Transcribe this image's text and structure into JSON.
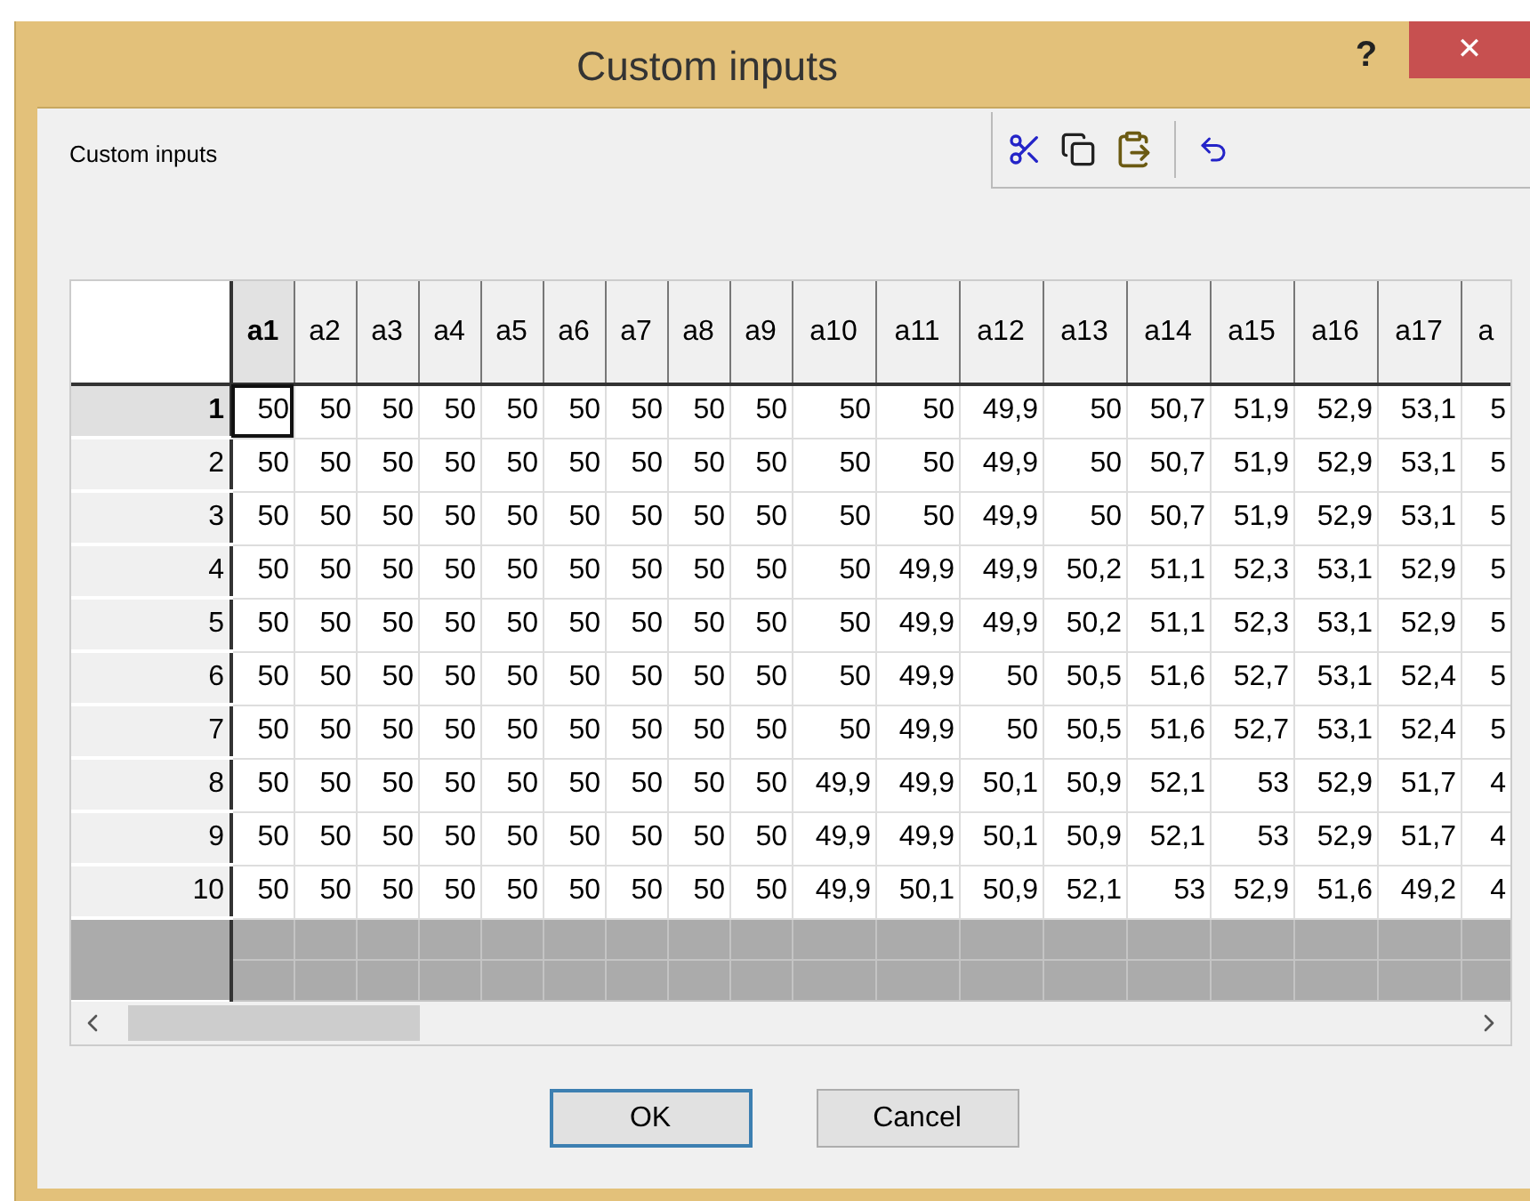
{
  "window": {
    "title": "Custom inputs",
    "help": "?",
    "close": "✕"
  },
  "panel_label": "Custom inputs",
  "toolbar": [
    {
      "kind": "cut"
    },
    {
      "kind": "copy"
    },
    {
      "kind": "paste"
    },
    {
      "kind": "separator"
    },
    {
      "kind": "undo"
    }
  ],
  "table": {
    "columns": [
      {
        "label": "a1",
        "selected": true
      },
      {
        "label": "a2",
        "selected": false
      },
      {
        "label": "a3",
        "selected": false
      },
      {
        "label": "a4",
        "selected": false
      },
      {
        "label": "a5",
        "selected": false
      },
      {
        "label": "a6",
        "selected": false
      },
      {
        "label": "a7",
        "selected": false
      },
      {
        "label": "a8",
        "selected": false
      },
      {
        "label": "a9",
        "selected": false
      },
      {
        "label": "a10",
        "selected": false
      },
      {
        "label": "a11",
        "selected": false
      },
      {
        "label": "a12",
        "selected": false
      },
      {
        "label": "a13",
        "selected": false
      },
      {
        "label": "a14",
        "selected": false
      },
      {
        "label": "a15",
        "selected": false
      },
      {
        "label": "a16",
        "selected": false
      },
      {
        "label": "a17",
        "selected": false
      },
      {
        "label": "a",
        "selected": false
      }
    ],
    "rows": [
      {
        "label": "1",
        "selected": true,
        "cells": [
          "50",
          "50",
          "50",
          "50",
          "50",
          "50",
          "50",
          "50",
          "50",
          "50",
          "50",
          "49,9",
          "50",
          "50,7",
          "51,9",
          "52,9",
          "53,1",
          "5"
        ]
      },
      {
        "label": "2",
        "selected": false,
        "cells": [
          "50",
          "50",
          "50",
          "50",
          "50",
          "50",
          "50",
          "50",
          "50",
          "50",
          "50",
          "49,9",
          "50",
          "50,7",
          "51,9",
          "52,9",
          "53,1",
          "5"
        ]
      },
      {
        "label": "3",
        "selected": false,
        "cells": [
          "50",
          "50",
          "50",
          "50",
          "50",
          "50",
          "50",
          "50",
          "50",
          "50",
          "50",
          "49,9",
          "50",
          "50,7",
          "51,9",
          "52,9",
          "53,1",
          "5"
        ]
      },
      {
        "label": "4",
        "selected": false,
        "cells": [
          "50",
          "50",
          "50",
          "50",
          "50",
          "50",
          "50",
          "50",
          "50",
          "50",
          "49,9",
          "49,9",
          "50,2",
          "51,1",
          "52,3",
          "53,1",
          "52,9",
          "5"
        ]
      },
      {
        "label": "5",
        "selected": false,
        "cells": [
          "50",
          "50",
          "50",
          "50",
          "50",
          "50",
          "50",
          "50",
          "50",
          "50",
          "49,9",
          "49,9",
          "50,2",
          "51,1",
          "52,3",
          "53,1",
          "52,9",
          "5"
        ]
      },
      {
        "label": "6",
        "selected": false,
        "cells": [
          "50",
          "50",
          "50",
          "50",
          "50",
          "50",
          "50",
          "50",
          "50",
          "50",
          "49,9",
          "50",
          "50,5",
          "51,6",
          "52,7",
          "53,1",
          "52,4",
          "5"
        ]
      },
      {
        "label": "7",
        "selected": false,
        "cells": [
          "50",
          "50",
          "50",
          "50",
          "50",
          "50",
          "50",
          "50",
          "50",
          "50",
          "49,9",
          "50",
          "50,5",
          "51,6",
          "52,7",
          "53,1",
          "52,4",
          "5"
        ]
      },
      {
        "label": "8",
        "selected": false,
        "cells": [
          "50",
          "50",
          "50",
          "50",
          "50",
          "50",
          "50",
          "50",
          "50",
          "49,9",
          "49,9",
          "50,1",
          "50,9",
          "52,1",
          "53",
          "52,9",
          "51,7",
          "4"
        ]
      },
      {
        "label": "9",
        "selected": false,
        "cells": [
          "50",
          "50",
          "50",
          "50",
          "50",
          "50",
          "50",
          "50",
          "50",
          "49,9",
          "49,9",
          "50,1",
          "50,9",
          "52,1",
          "53",
          "52,9",
          "51,7",
          "4"
        ]
      },
      {
        "label": "10",
        "selected": false,
        "cells": [
          "50",
          "50",
          "50",
          "50",
          "50",
          "50",
          "50",
          "50",
          "50",
          "49,9",
          "50,1",
          "50,9",
          "52,1",
          "53",
          "52,9",
          "51,6",
          "49,2",
          "4"
        ]
      }
    ]
  },
  "buttons": [
    {
      "label": "OK",
      "default": true
    },
    {
      "label": "Cancel",
      "default": false
    }
  ]
}
